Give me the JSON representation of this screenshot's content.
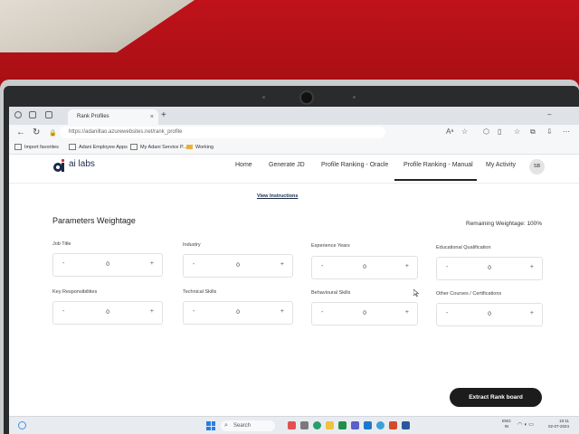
{
  "browser": {
    "tab_title": "Rank Profiles",
    "tab_close": "×",
    "new_tab": "+",
    "url": "https://adaniltao.azurewebsites.net/rank_profile",
    "bookmarks": [
      "Import favorites",
      "Adani Employee Apps",
      "My Adani Service P...",
      "Working"
    ]
  },
  "app": {
    "logo_text": "ai labs",
    "nav": [
      "Home",
      "Generate JD",
      "Profile Ranking - Oracle",
      "Profile Ranking - Manual",
      "My Activity"
    ],
    "active_nav": "Profile Ranking - Manual",
    "avatar": "SB",
    "instructions_link": "View Instructions",
    "section_title": "Parameters Weightage",
    "remaining": "Remaining Weightage: 100%",
    "params": [
      {
        "label": "Job Title",
        "value": "0"
      },
      {
        "label": "Industry",
        "value": "0"
      },
      {
        "label": "Experience Years",
        "value": "0"
      },
      {
        "label": "Educational Qualification",
        "value": "0"
      },
      {
        "label": "Key Responsibilities",
        "value": "0"
      },
      {
        "label": "Technical Skills",
        "value": "0"
      },
      {
        "label": "Behavioural Skills",
        "value": "0"
      },
      {
        "label": "Other Courses / Certifications",
        "value": "0"
      }
    ],
    "minus": "-",
    "plus": "+",
    "extract_button": "Extract Rank board"
  },
  "taskbar": {
    "search": "Search",
    "lang": [
      "ENG",
      "IN"
    ],
    "time": "10:11",
    "date": "02-07-2024"
  },
  "colors": {
    "primary_button": "#1c1c1c",
    "logo": "#1b2a4a"
  }
}
